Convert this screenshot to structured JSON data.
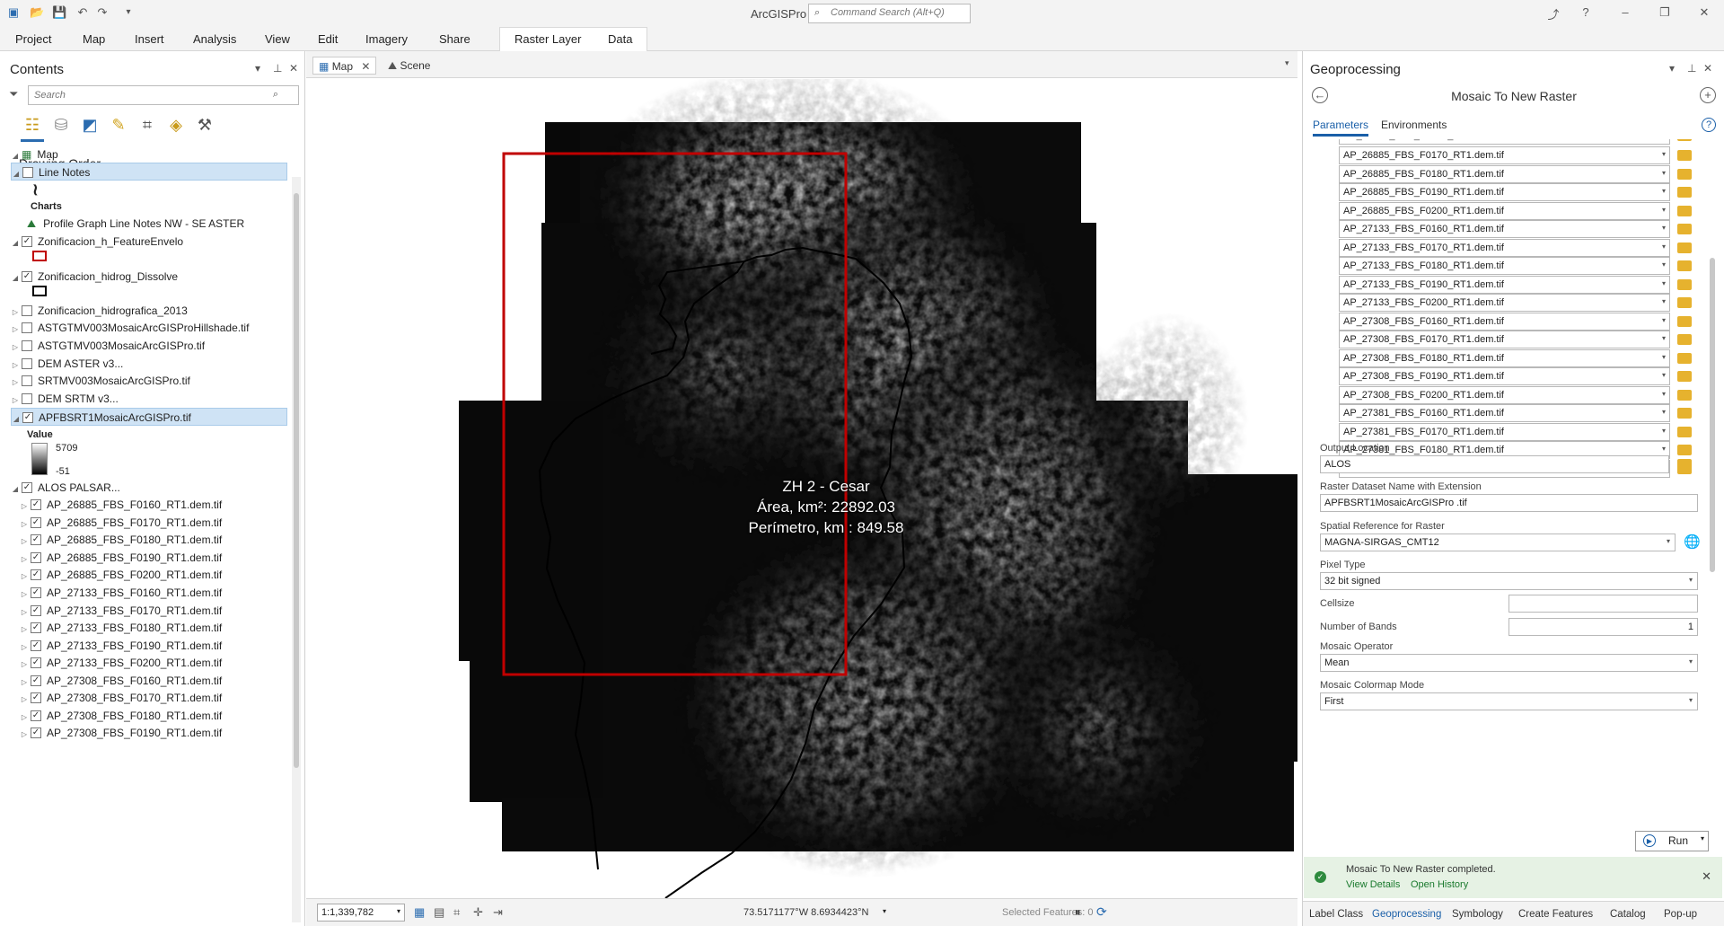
{
  "app": {
    "title": "ArcGISPro",
    "command_search_placeholder": "Command Search (Alt+Q)"
  },
  "ribbon": {
    "tabs": [
      "Project",
      "Map",
      "Insert",
      "Analysis",
      "View",
      "Edit",
      "Imagery",
      "Share"
    ],
    "context_tabs": [
      "Raster Layer",
      "Data"
    ]
  },
  "contents": {
    "title": "Contents",
    "search_placeholder": "Search",
    "section": "Drawing Order",
    "items": [
      {
        "label": "Map",
        "checked": null
      },
      {
        "label": "Line Notes",
        "checked": false
      },
      {
        "label": "Charts",
        "checked": null
      },
      {
        "label": "Profile Graph Line Notes NW - SE ASTER",
        "checked": null
      },
      {
        "label": "Zonificacion_h_FeatureEnvelo",
        "checked": true
      },
      {
        "label": "Zonificacion_hidrog_Dissolve",
        "checked": true
      },
      {
        "label": "Zonificacion_hidrografica_2013",
        "checked": false
      },
      {
        "label": "ASTGTMV003MosaicArcGISProHillshade.tif",
        "checked": false
      },
      {
        "label": "ASTGTMV003MosaicArcGISPro.tif",
        "checked": false
      },
      {
        "label": "DEM ASTER v3...",
        "checked": false
      },
      {
        "label": "SRTMV003MosaicArcGISPro.tif",
        "checked": false
      },
      {
        "label": "DEM SRTM v3...",
        "checked": false
      },
      {
        "label": "APFBSRT1MosaicArcGISPro.tif",
        "checked": true
      },
      {
        "label": "ALOS PALSAR...",
        "checked": true
      },
      {
        "label": "AP_26885_FBS_F0160_RT1.dem.tif",
        "checked": true
      },
      {
        "label": "AP_26885_FBS_F0170_RT1.dem.tif",
        "checked": true
      },
      {
        "label": "AP_26885_FBS_F0180_RT1.dem.tif",
        "checked": true
      },
      {
        "label": "AP_26885_FBS_F0190_RT1.dem.tif",
        "checked": true
      },
      {
        "label": "AP_26885_FBS_F0200_RT1.dem.tif",
        "checked": true
      },
      {
        "label": "AP_27133_FBS_F0160_RT1.dem.tif",
        "checked": true
      },
      {
        "label": "AP_27133_FBS_F0170_RT1.dem.tif",
        "checked": true
      },
      {
        "label": "AP_27133_FBS_F0180_RT1.dem.tif",
        "checked": true
      },
      {
        "label": "AP_27133_FBS_F0190_RT1.dem.tif",
        "checked": true
      },
      {
        "label": "AP_27133_FBS_F0200_RT1.dem.tif",
        "checked": true
      },
      {
        "label": "AP_27308_FBS_F0160_RT1.dem.tif",
        "checked": true
      },
      {
        "label": "AP_27308_FBS_F0170_RT1.dem.tif",
        "checked": true
      },
      {
        "label": "AP_27308_FBS_F0180_RT1.dem.tif",
        "checked": true
      },
      {
        "label": "AP_27308_FBS_F0190_RT1.dem.tif",
        "checked": true
      }
    ],
    "legend": {
      "title": "Value",
      "high": "5709",
      "low": "-51"
    }
  },
  "map": {
    "tabs": [
      "Map",
      "Scene"
    ],
    "label_lines": [
      "ZH 2 - Cesar",
      "Área, km²: 22892.03",
      "Perímetro, km : 849.58"
    ],
    "scale": "1:1,339,782",
    "coords": "73.5171177°W 8.6934423°N",
    "selected_features": "Selected Features: 0"
  },
  "geoprocessing": {
    "title": "Geoprocessing",
    "tool": "Mosaic To New Raster",
    "tabs": [
      "Parameters",
      "Environments"
    ],
    "input_rasters": [
      "AP_26885_FBS_F0170_RT1.dem.tif",
      "AP_26885_FBS_F0180_RT1.dem.tif",
      "AP_26885_FBS_F0190_RT1.dem.tif",
      "AP_26885_FBS_F0200_RT1.dem.tif",
      "AP_27133_FBS_F0160_RT1.dem.tif",
      "AP_27133_FBS_F0170_RT1.dem.tif",
      "AP_27133_FBS_F0180_RT1.dem.tif",
      "AP_27133_FBS_F0190_RT1.dem.tif",
      "AP_27133_FBS_F0200_RT1.dem.tif",
      "AP_27308_FBS_F0160_RT1.dem.tif",
      "AP_27308_FBS_F0170_RT1.dem.tif",
      "AP_27308_FBS_F0180_RT1.dem.tif",
      "AP_27308_FBS_F0190_RT1.dem.tif",
      "AP_27308_FBS_F0200_RT1.dem.tif",
      "AP_27381_FBS_F0160_RT1.dem.tif",
      "AP_27381_FBS_F0170_RT1.dem.tif",
      "AP_27381_FBS_F0180_RT1.dem.tif",
      ""
    ],
    "output_location": {
      "label": "Output Location",
      "value": "ALOS"
    },
    "raster_name": {
      "label": "Raster Dataset Name with Extension",
      "value": "APFBSRT1MosaicArcGISPro .tif"
    },
    "spatial_ref": {
      "label": "Spatial Reference for  Raster",
      "value": "MAGNA-SIRGAS_CMT12"
    },
    "pixel_type": {
      "label": "Pixel Type",
      "value": "32 bit signed"
    },
    "cellsize": {
      "label": "Cellsize",
      "value": ""
    },
    "bands": {
      "label": "Number of Bands",
      "value": "1"
    },
    "operator": {
      "label": "Mosaic Operator",
      "value": "Mean"
    },
    "colormap": {
      "label": "Mosaic Colormap Mode",
      "value": "First"
    },
    "run_label": "Run",
    "notice": {
      "message": "Mosaic To New Raster completed.",
      "details": "View Details",
      "history": "Open History"
    },
    "bottom_tabs": [
      "Label Class",
      "Geoprocessing",
      "Symbology",
      "Create Features",
      "Catalog",
      "Pop-up"
    ]
  },
  "colors": {
    "accent": "#1a5fa8",
    "extent_frame": "#c00000",
    "success": "#2e8b3e"
  }
}
